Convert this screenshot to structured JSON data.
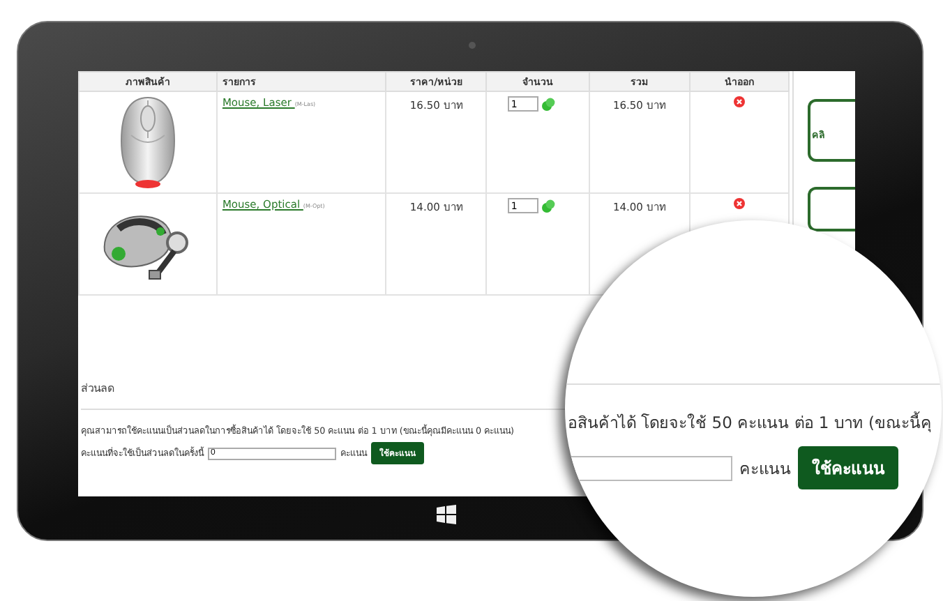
{
  "table": {
    "columns": [
      "ภาพสินค้า",
      "รายการ",
      "ราคา/หน่วย",
      "จำนวน",
      "รวม",
      "นำออก"
    ],
    "rows": [
      {
        "kind": "laser",
        "name": "Mouse, Laser ",
        "code": "(M-Las)",
        "price": "16.50 บาท",
        "quantity": "1",
        "total": "16.50 บาท"
      },
      {
        "kind": "optical",
        "name": "Mouse, Optical ",
        "code": "(M-Opt)",
        "price": "14.00 บาท",
        "quantity": "1",
        "total": "14.00 บาท"
      }
    ]
  },
  "side_panel": {
    "items": [
      "คลิ"
    ]
  },
  "discount": {
    "title": "ส่วนลด",
    "info": "คุณสามารถใช้คะแนนเป็นส่วนลดในการซื้อสินค้าได้ โดยจะใช้ 50 คะแนน ต่อ 1 บาท (ขณะนี้คุณมีคะแนน 0 คะแนน)",
    "points_label": "คะแนนที่จะใช้เป็นส่วนลดในครั้งนี้",
    "points_value": "0",
    "unit": "คะแนน",
    "button": "ใช้คะแนน"
  },
  "magnifier": {
    "info": "อสินค้าได้ โดยจะใช้ 50 คะแนน ต่อ 1 บาท (ขณะนี้คุ",
    "unit": "คะแนน",
    "button": "ใช้คะแนน"
  }
}
